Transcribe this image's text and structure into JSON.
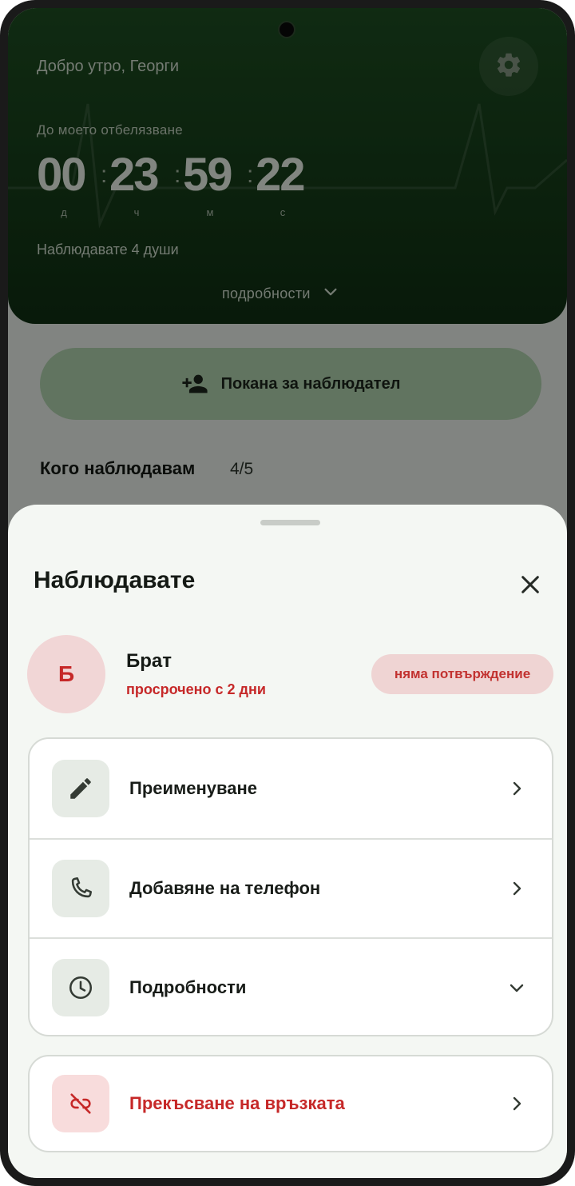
{
  "header": {
    "greeting": "Добро утро, Георги",
    "countdown_label": "До моето отбелязване",
    "timer": {
      "days": "00",
      "hours": "23",
      "minutes": "59",
      "seconds": "22",
      "unit_days": "д",
      "unit_hours": "ч",
      "unit_minutes": "м",
      "unit_seconds": "с"
    },
    "watching": "Наблюдавате 4 души",
    "details_label": "подробности",
    "settings_icon": "gear-icon"
  },
  "invite": {
    "label": "Покана за наблюдател",
    "icon": "person-add-icon"
  },
  "list": {
    "title": "Кого наблюдавам",
    "count": "4/5"
  },
  "sheet": {
    "title": "Наблюдавате",
    "close_icon": "close-icon",
    "person": {
      "initial": "Б",
      "name": "Брат",
      "status": "просрочено с 2 дни",
      "badge": "няма потвърждение"
    },
    "actions": [
      {
        "label": "Преименуване",
        "icon": "pencil-icon",
        "chevron": "chevron-right-icon"
      },
      {
        "label": "Добавяне на телефон",
        "icon": "phone-icon",
        "chevron": "chevron-right-icon"
      },
      {
        "label": "Подробности",
        "icon": "clock-icon",
        "chevron": "chevron-down-icon"
      }
    ],
    "danger_action": {
      "label": "Прекъсване на връзката",
      "icon": "link-off-icon",
      "chevron": "chevron-right-icon"
    }
  },
  "colors": {
    "header_green": "#1c4a20",
    "accent_red": "#c62828",
    "invite_green": "#a8c8a6",
    "sheet_bg": "#f4f7f3"
  }
}
